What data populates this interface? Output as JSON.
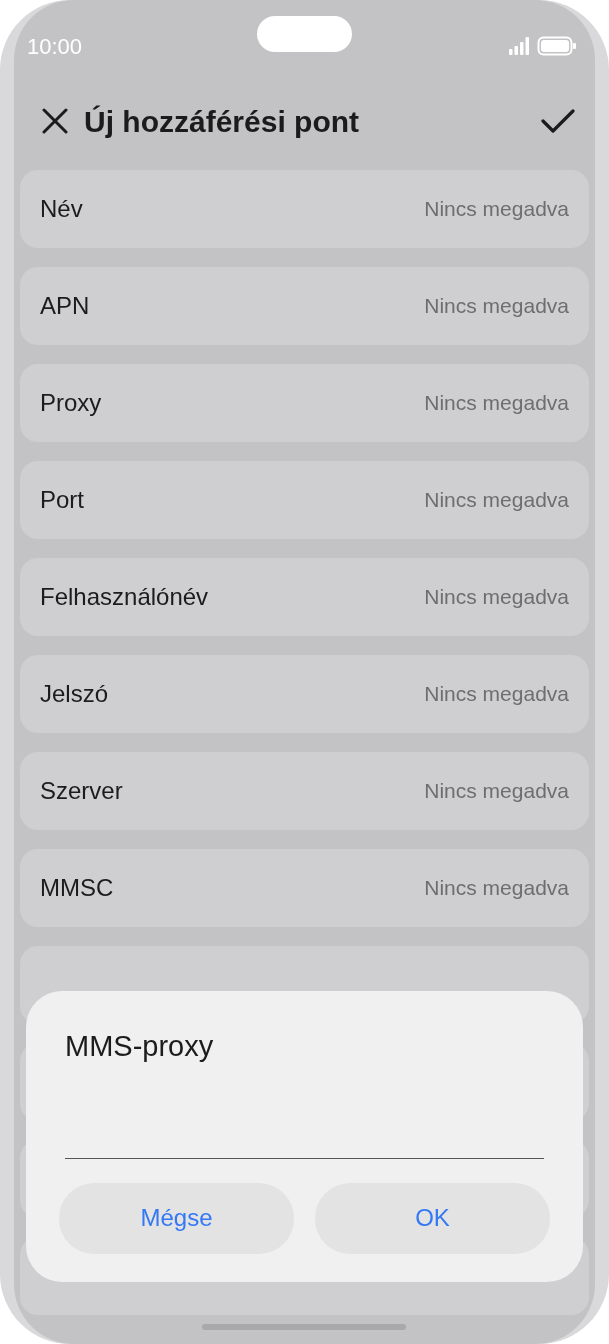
{
  "status_bar": {
    "time": "10:00"
  },
  "header": {
    "title": "Új hozzáférési pont"
  },
  "rows": [
    {
      "label": "Név",
      "value": "Nincs megadva"
    },
    {
      "label": "APN",
      "value": "Nincs megadva"
    },
    {
      "label": "Proxy",
      "value": "Nincs megadva"
    },
    {
      "label": "Port",
      "value": "Nincs megadva"
    },
    {
      "label": "Felhasználónév",
      "value": "Nincs megadva"
    },
    {
      "label": "Jelszó",
      "value": "Nincs megadva"
    },
    {
      "label": "Szerver",
      "value": "Nincs megadva"
    },
    {
      "label": "MMSC",
      "value": "Nincs megadva"
    }
  ],
  "dialog": {
    "title": "MMS-proxy",
    "buttons": [
      "Mégse",
      "OK"
    ]
  }
}
